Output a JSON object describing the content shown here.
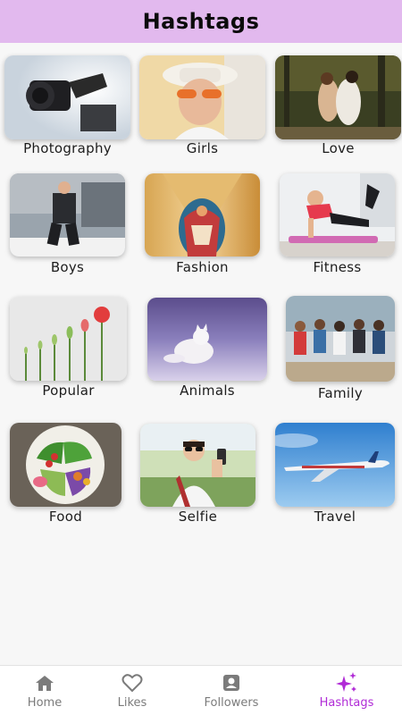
{
  "header": {
    "title": "Hashtags"
  },
  "categories": [
    {
      "label": "Photography",
      "icon": "camera-photo"
    },
    {
      "label": "Girls",
      "icon": "girl-photo"
    },
    {
      "label": "Love",
      "icon": "couple-photo"
    },
    {
      "label": "Boys",
      "icon": "boy-photo"
    },
    {
      "label": "Fashion",
      "icon": "fashion-photo"
    },
    {
      "label": "Fitness",
      "icon": "fitness-photo"
    },
    {
      "label": "Popular",
      "icon": "flowers-photo"
    },
    {
      "label": "Animals",
      "icon": "arctic-fox-photo"
    },
    {
      "label": "Family",
      "icon": "family-photo"
    },
    {
      "label": "Food",
      "icon": "salad-photo"
    },
    {
      "label": "Selfie",
      "icon": "selfie-photo"
    },
    {
      "label": "Travel",
      "icon": "airplane-photo"
    }
  ],
  "nav": {
    "items": [
      {
        "label": "Home",
        "icon": "home-icon"
      },
      {
        "label": "Likes",
        "icon": "heart-icon"
      },
      {
        "label": "Followers",
        "icon": "contact-icon"
      },
      {
        "label": "Hashtags",
        "icon": "sparkle-icon"
      }
    ],
    "active_color": "#b02bd6",
    "inactive_color": "#7b7b7b"
  },
  "colors": {
    "header_bg": "#e2b9ee",
    "page_bg": "#f7f7f7"
  }
}
